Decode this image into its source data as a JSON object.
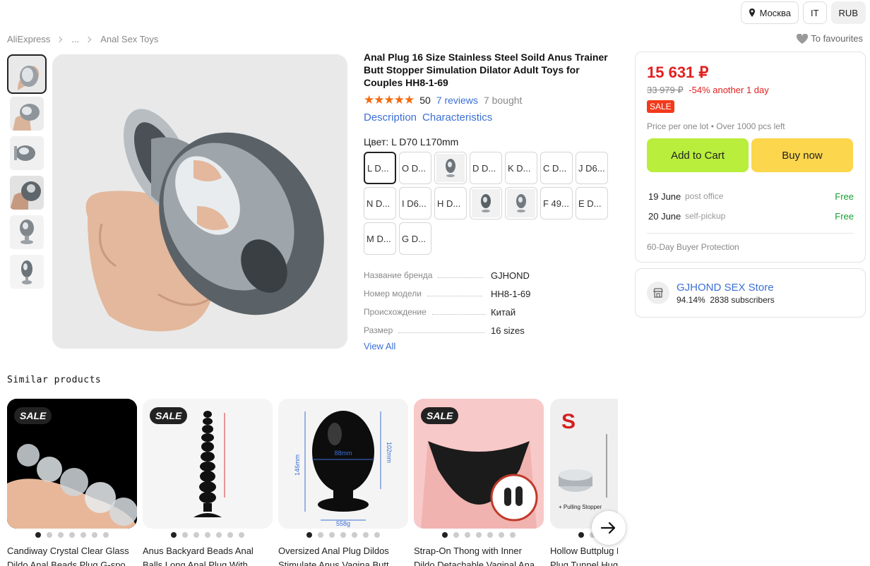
{
  "header": {
    "location": "Москва",
    "language": "IT",
    "currency": "RUB"
  },
  "breadcrumb": {
    "root": "AliExpress",
    "ellipsis": "...",
    "category": "Anal Sex Toys"
  },
  "favourites_label": "To favourites",
  "product": {
    "title": "Anal Plug 16 Size Stainless Steel Soild Anus Trainer Butt Stopper Simulation Dilator Adult Toys for Couples HH8-1-69",
    "stars": "★★★★★",
    "rating": "50",
    "reviews": "7 reviews",
    "bought": "7 bought",
    "tabs": [
      "Description",
      "Characteristics"
    ],
    "color_label": "Цвет: L D70 L170mm",
    "swatches": [
      {
        "label": "L D..."
      },
      {
        "label": "O D..."
      },
      {
        "label": ""
      },
      {
        "label": "D D..."
      },
      {
        "label": "K D..."
      },
      {
        "label": "C D..."
      },
      {
        "label": "J D6..."
      },
      {
        "label": "N D..."
      },
      {
        "label": "I D6..."
      },
      {
        "label": "H D..."
      },
      {
        "label": ""
      },
      {
        "label": ""
      },
      {
        "label": "F 49..."
      },
      {
        "label": "E D..."
      },
      {
        "label": "M D..."
      },
      {
        "label": "G D..."
      }
    ],
    "specs": [
      {
        "key": "Название бренда",
        "value": "GJHOND"
      },
      {
        "key": "Номер модели",
        "value": "HH8-1-69"
      },
      {
        "key": "Происхождение",
        "value": "Китай"
      },
      {
        "key": "Размер",
        "value": "16 sizes"
      }
    ],
    "view_all": "View All"
  },
  "buybox": {
    "price": "15 631 ₽",
    "old_price": "33 979 ₽",
    "discount": "-54% another 1 day",
    "sale": "SALE",
    "lot_info": "Price per one lot • Over 1000 pcs left",
    "add_to_cart": "Add to Cart",
    "buy_now": "Buy now",
    "shipping": [
      {
        "date": "19 June",
        "type": "post office",
        "price": "Free"
      },
      {
        "date": "20 June",
        "type": "self-pickup",
        "price": "Free"
      }
    ],
    "protection": "60-Day Buyer Protection"
  },
  "store": {
    "name": "GJHOND SEX Store",
    "rating": "94.14%",
    "subscribers": "2838 subscribers"
  },
  "similar": {
    "title": "Similar products",
    "items": [
      {
        "badge": "SALE",
        "title": "Candiway Crystal Clear Glass Dildo Anal Beads Plug G-spo..."
      },
      {
        "badge": "SALE",
        "title": "Anus Backyard Beads Anal Balls Long Anal Plug With ..."
      },
      {
        "badge": "",
        "title": "Oversized Anal Plug Dildos Stimulate Anus Vagina Butt ..."
      },
      {
        "badge": "SALE",
        "title": "Strap-On Thong with Inner Dildo,Detachable Vaginal Ana..."
      },
      {
        "badge": "",
        "title": "Hollow Buttplug Large Anal Plug Tunnel Hug..."
      }
    ],
    "image_text": {
      "card3_width": "88mm",
      "card3_height": "102mm",
      "card3_total": "146mm",
      "card3_weight": "558g",
      "card5_letter": "S",
      "card5_caption": "+ Pulling Stopper"
    }
  },
  "colors": {
    "price_red": "#e32020",
    "link_blue": "#3b6fd6",
    "cart_green": "#b9ee3c",
    "buy_yellow": "#fcd64c",
    "free_green": "#15a030",
    "star_orange": "#f56b10"
  }
}
